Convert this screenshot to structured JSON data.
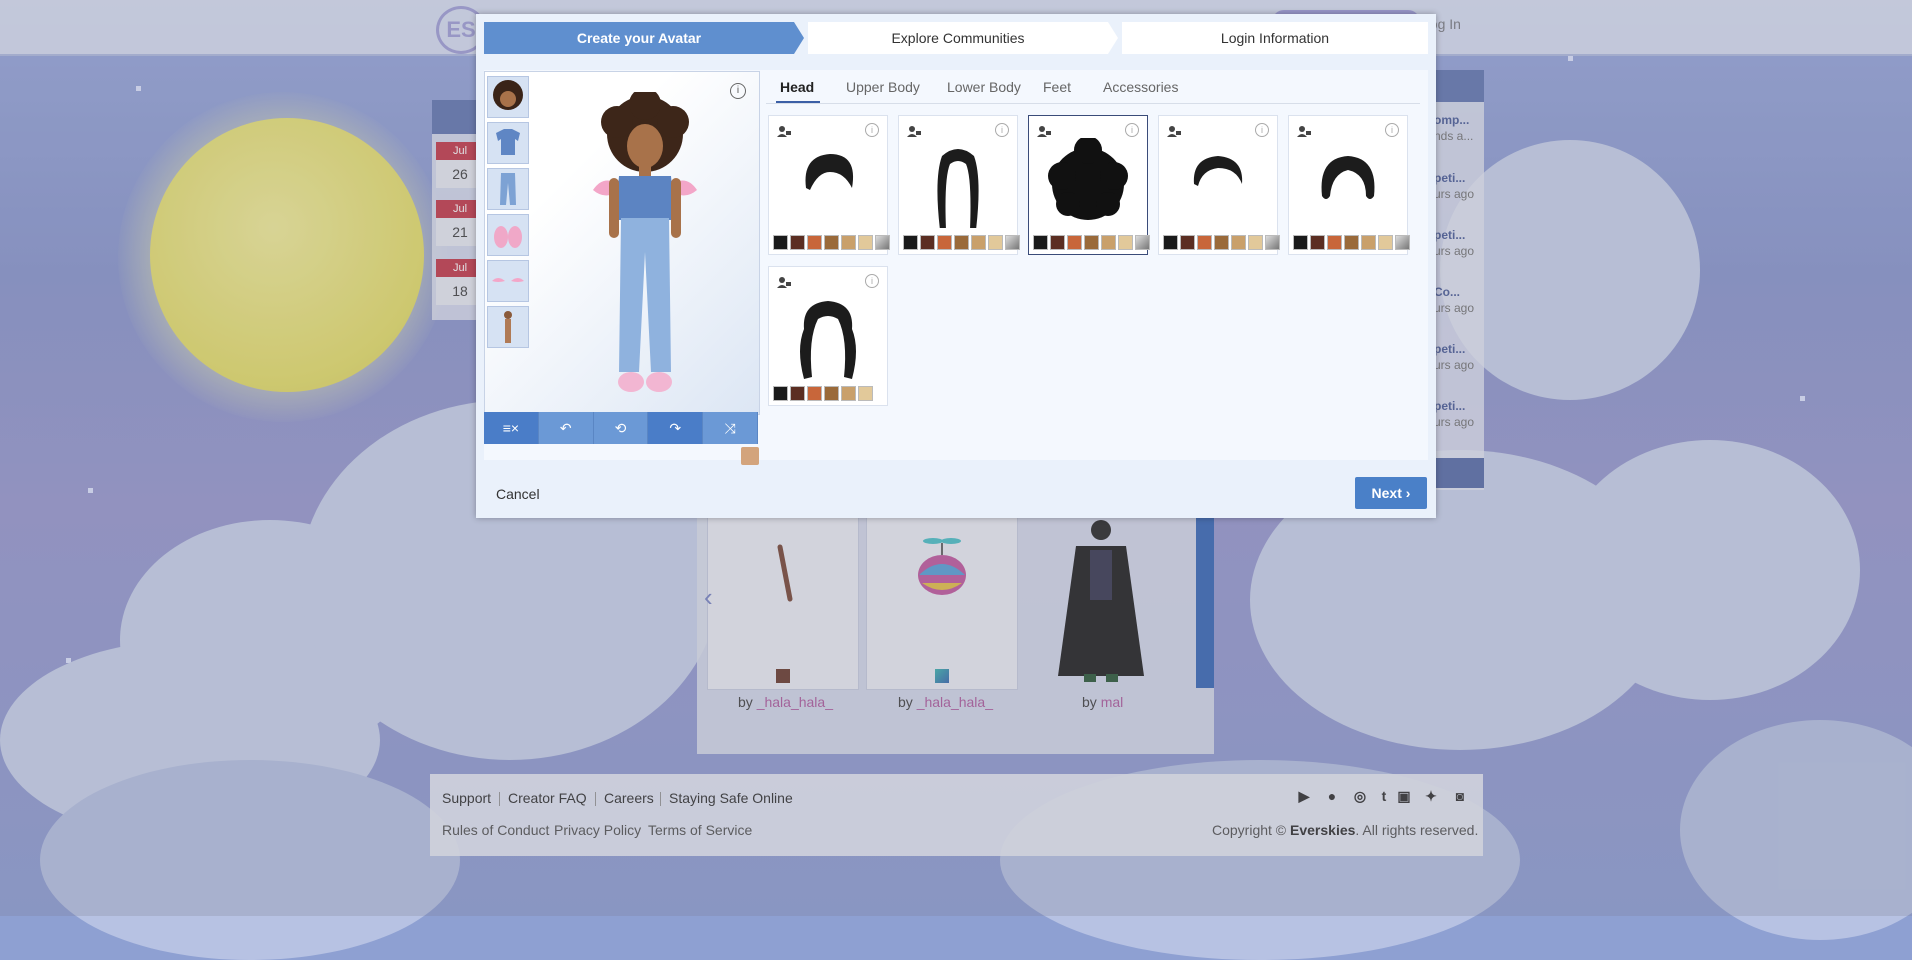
{
  "header": {
    "login_label": "Log In",
    "logo_letter": "ES"
  },
  "background_page": {
    "calendar": [
      {
        "month": "Jul",
        "day": "26"
      },
      {
        "month": "Jul",
        "day": "21"
      },
      {
        "month": "Jul",
        "day": "18"
      }
    ],
    "right_list": [
      {
        "title": "omp...",
        "sub": "nds a..."
      },
      {
        "title": "peti...",
        "sub": "urs ago"
      },
      {
        "title": "peti...",
        "sub": "urs ago"
      },
      {
        "title": "Co...",
        "sub": "urs ago"
      },
      {
        "title": "peti...",
        "sub": "urs ago"
      },
      {
        "title": "peti...",
        "sub": "urs ago"
      }
    ],
    "carousel_items": [
      {
        "by": "by",
        "user": "_hala_hala_"
      },
      {
        "by": "by",
        "user": "_hala_hala_"
      },
      {
        "by": "by",
        "user": "mal"
      }
    ]
  },
  "footer": {
    "links1": [
      "Support",
      "Creator FAQ",
      "Careers",
      "Staying Safe Online"
    ],
    "links2": [
      "Rules of Conduct",
      "Privacy Policy",
      "Terms of Service"
    ],
    "copyright_prefix": "Copyright ©",
    "brand": "Everskies",
    "copyright_suffix": ". All rights reserved.",
    "social_icons": [
      "google-play-icon",
      "apple-icon",
      "instagram-icon",
      "tumblr-icon",
      "youtube-icon",
      "twitter-icon",
      "discord-icon"
    ]
  },
  "modal": {
    "steps": [
      "Create your Avatar",
      "Explore Communities",
      "Login Information"
    ],
    "active_step": 0,
    "tabs": [
      "Head",
      "Upper Body",
      "Lower Body",
      "Feet",
      "Accessories"
    ],
    "active_tab": "Head",
    "selected_hair_index": 2,
    "cancel_label": "Cancel",
    "next_label": "Next",
    "toolbar": [
      "clear-icon",
      "undo-icon",
      "undo-all-icon",
      "redo-icon",
      "shuffle-icon"
    ],
    "hair_swatches": [
      "#1a1a1a",
      "#5b2e22",
      "#c8663a",
      "#9a6a3a",
      "#c9a06b",
      "#e2c99a",
      "#9a9a9a"
    ],
    "colors": {
      "step_active": "#5f8fcf",
      "button": "#4a80c8",
      "skin": "#d3a47c"
    }
  }
}
